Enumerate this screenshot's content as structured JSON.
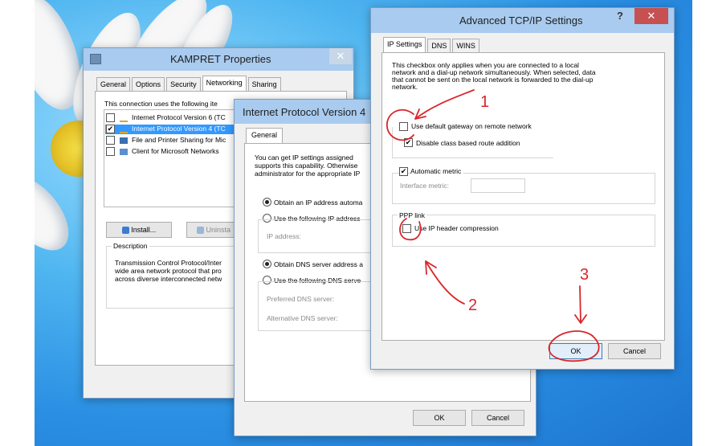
{
  "kampret": {
    "title": "KAMPRET Properties",
    "tabs": [
      "General",
      "Options",
      "Security",
      "Networking",
      "Sharing"
    ],
    "connection_uses": "This connection uses the following ite",
    "items": [
      {
        "label": "Internet Protocol Version 6 (TC",
        "checked": false
      },
      {
        "label": "Internet Protocol Version 4 (TC",
        "checked": true
      },
      {
        "label": "File and Printer Sharing for Mic",
        "checked": false
      },
      {
        "label": "Client for Microsoft Networks",
        "checked": false
      }
    ],
    "install_label": "Install...",
    "uninstall_label": "Uninsta",
    "description_label": "Description",
    "description_text": [
      "Transmission Control Protocol/Inter",
      "wide area network protocol that pro",
      "across diverse interconnected netw"
    ]
  },
  "ipv4": {
    "title": "Internet Protocol Version 4",
    "tab": "General",
    "intro": [
      "You can get IP settings assigned",
      "supports this capability. Otherwise",
      "administrator for the appropriate IP"
    ],
    "obtain_ip": "Obtain an IP address automa",
    "use_ip": "Use the following IP address",
    "ip_address_label": "IP address:",
    "obtain_dns": "Obtain DNS server address a",
    "use_dns": "Use the following DNS serve",
    "preferred_dns": "Preferred DNS server:",
    "alternative_dns": "Alternative DNS server:",
    "ok_label": "OK",
    "cancel_label": "Cancel"
  },
  "advanced": {
    "title": "Advanced TCP/IP Settings",
    "help_label": "?",
    "close_label": "✕",
    "tabs": [
      "IP Settings",
      "DNS",
      "WINS"
    ],
    "info": [
      "This checkbox only applies when you are connected to a local",
      "network and a dial-up network simultaneously. When selected, data",
      "that cannot be sent on the local network is forwarded to the dial-up",
      "network."
    ],
    "use_default_gateway": "Use default gateway on remote network",
    "disable_class_route": "Disable class based route addition",
    "automatic_metric": "Automatic metric",
    "interface_metric": "Interface metric:",
    "ppp_link": "PPP link",
    "use_ip_header": "Use IP header compression",
    "ok_label": "OK",
    "cancel_label": "Cancel"
  },
  "annotations": {
    "one": "1",
    "two": "2",
    "three": "3"
  },
  "colors": {
    "titlebar": "#a9cbef",
    "close_red": "#c75050",
    "annotation_red": "#d9262b"
  },
  "checkbox_states": {
    "use_default_gateway": false,
    "disable_class_route": true,
    "automatic_metric": true,
    "use_ip_header": false
  }
}
